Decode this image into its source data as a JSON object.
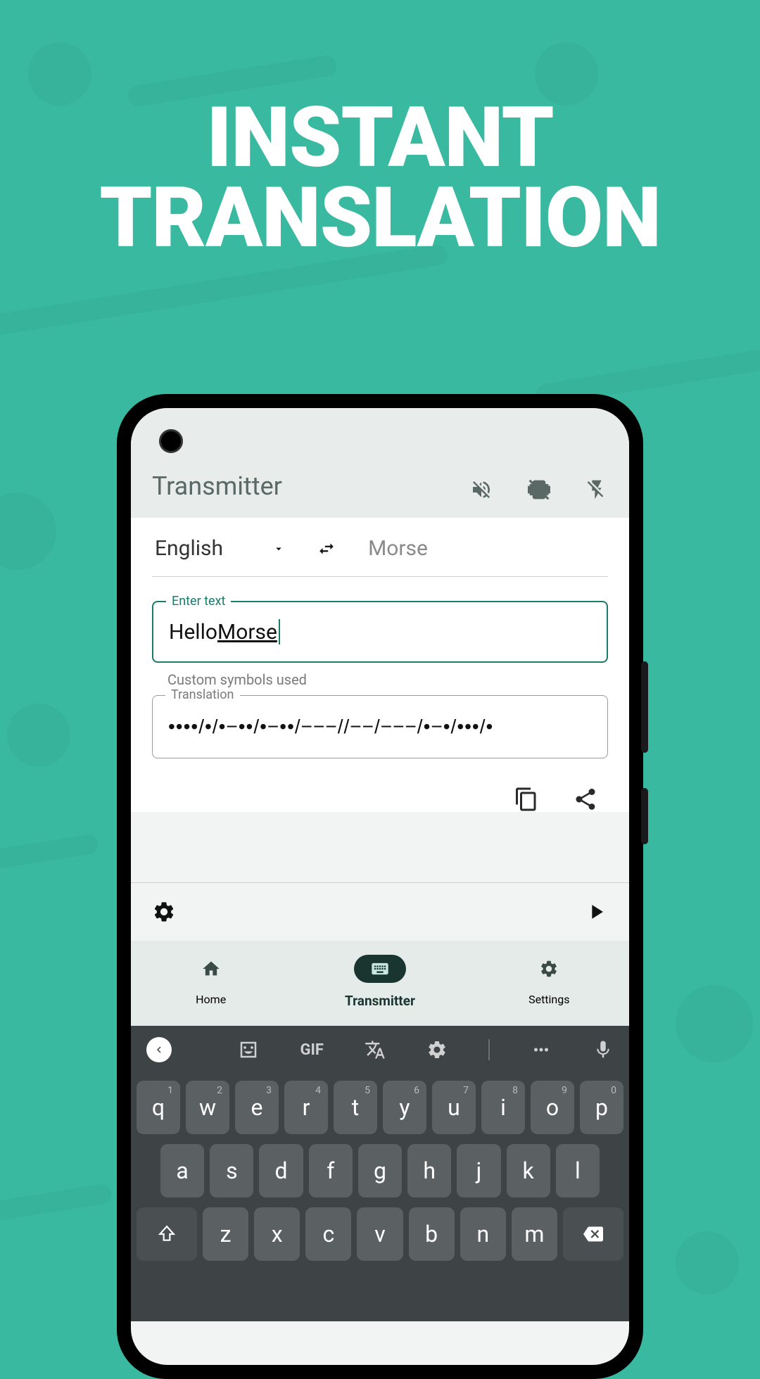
{
  "hero": {
    "line1": "INSTANT",
    "line2": "TRANSLATION"
  },
  "header": {
    "title": "Transmitter"
  },
  "translator": {
    "src_lang": "English",
    "dst_lang": "Morse",
    "input_label": "Enter text",
    "input_text_plain": "Hello ",
    "input_text_underlined": "Morse",
    "hint": "Custom symbols used",
    "translation_label": "Translation",
    "translation_text": "••••/•/•−••/•−••/−−−//−−/−−−/•−•/•••/•"
  },
  "bottom_nav": {
    "items": [
      {
        "label": "Home"
      },
      {
        "label": "Transmitter"
      },
      {
        "label": "Settings"
      }
    ]
  },
  "keyboard": {
    "gif": "GIF",
    "row1": [
      {
        "k": "q",
        "s": "1"
      },
      {
        "k": "w",
        "s": "2"
      },
      {
        "k": "e",
        "s": "3"
      },
      {
        "k": "r",
        "s": "4"
      },
      {
        "k": "t",
        "s": "5"
      },
      {
        "k": "y",
        "s": "6"
      },
      {
        "k": "u",
        "s": "7"
      },
      {
        "k": "i",
        "s": "8"
      },
      {
        "k": "o",
        "s": "9"
      },
      {
        "k": "p",
        "s": "0"
      }
    ],
    "row2": [
      {
        "k": "a"
      },
      {
        "k": "s"
      },
      {
        "k": "d"
      },
      {
        "k": "f"
      },
      {
        "k": "g"
      },
      {
        "k": "h"
      },
      {
        "k": "j"
      },
      {
        "k": "k"
      },
      {
        "k": "l"
      }
    ],
    "row3": [
      {
        "k": "z"
      },
      {
        "k": "x"
      },
      {
        "k": "c"
      },
      {
        "k": "v"
      },
      {
        "k": "b"
      },
      {
        "k": "n"
      },
      {
        "k": "m"
      }
    ]
  }
}
